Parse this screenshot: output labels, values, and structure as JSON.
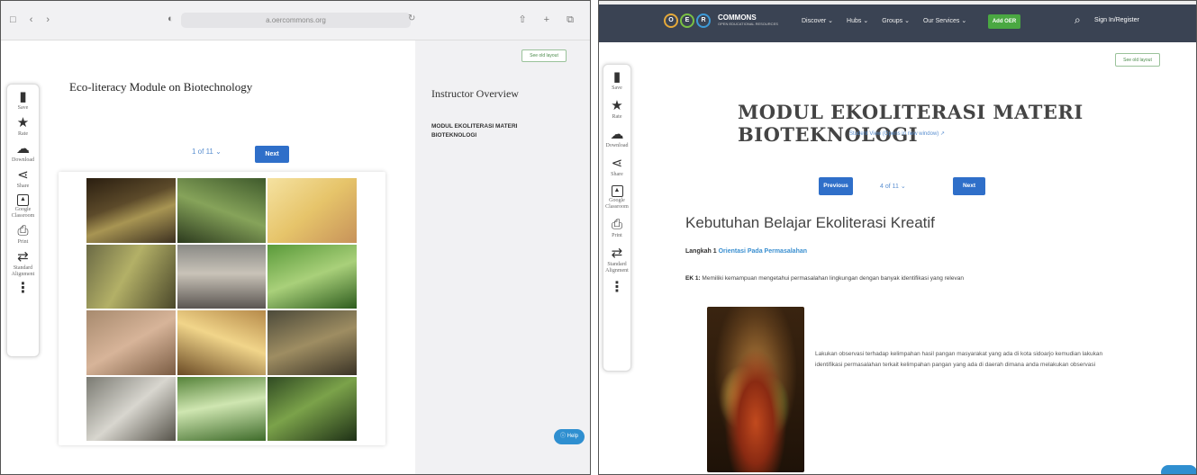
{
  "left": {
    "browser": {
      "url": "a.oercommons.org"
    },
    "toolbar": [
      {
        "icon": "bookmark-icon",
        "label": "Save"
      },
      {
        "icon": "star-icon",
        "label": "Rate"
      },
      {
        "icon": "download-icon",
        "label": "Download"
      },
      {
        "icon": "share-icon",
        "label": "Share"
      },
      {
        "icon": "google-classroom-icon",
        "label": "Google Classroom"
      },
      {
        "icon": "print-icon",
        "label": "Print"
      },
      {
        "icon": "alignment-icon",
        "label": "Standard Alignment"
      },
      {
        "icon": "more-icon",
        "label": ""
      }
    ],
    "title": "Eco-literacy Module on Biotechnology",
    "pager": "1 of 11",
    "next_label": "Next",
    "sidebar": {
      "see_old_layout": "See old layout",
      "heading": "Instructor Overview",
      "subheading": "MODUL EKOLITERASI MATERI BIOTEKNOLOGI",
      "help_label": "Help"
    }
  },
  "right": {
    "brand": {
      "name": "COMMONS",
      "tagline": "OPEN EDUCATIONAL RESOURCES",
      "letters": [
        "O",
        "E",
        "R"
      ]
    },
    "nav": [
      "Discover ⌄",
      "Hubs ⌄",
      "Groups ⌄",
      "Our Services ⌄"
    ],
    "add_oer": "Add OER",
    "sign_in": "Sign In/Register",
    "toolbar": [
      {
        "icon": "bookmark-icon",
        "label": "Save"
      },
      {
        "icon": "star-icon",
        "label": "Rate"
      },
      {
        "icon": "download-icon",
        "label": "Download"
      },
      {
        "icon": "share-icon",
        "label": "Share"
      },
      {
        "icon": "google-classroom-icon",
        "label": "Google Classroom"
      },
      {
        "icon": "print-icon",
        "label": "Print"
      },
      {
        "icon": "alignment-icon",
        "label": "Standard Alignment"
      },
      {
        "icon": "more-icon",
        "label": ""
      }
    ],
    "see_old_layout": "See old layout",
    "title": "MODUL EKOLITERASI MATERI BIOTEKNOLOGI",
    "student_view": "Student View (Opens in new window) ↗",
    "previous_label": "Previous",
    "pager": "4 of 11",
    "next_label": "Next",
    "section_heading": "Kebutuhan Belajar Ekoliterasi Kreatif",
    "step_prefix": "Langkah 1 ",
    "step_highlight": "Orientasi Pada Permasalahan",
    "ek_label": "EK 1:",
    "ek_text": " Memiliki kemampuan mengetahui permasalahan lingkungan dengan banyak identifikasi yang relevan",
    "body": "Lakukan observasi terhadap kelimpahan hasil pangan masyarakat yang ada di kota sidoarjo kemudian lakukan identifikasi permasalahan terkait kelimpahan pangan yang ada di daerah dimana anda melakukan observasi"
  }
}
